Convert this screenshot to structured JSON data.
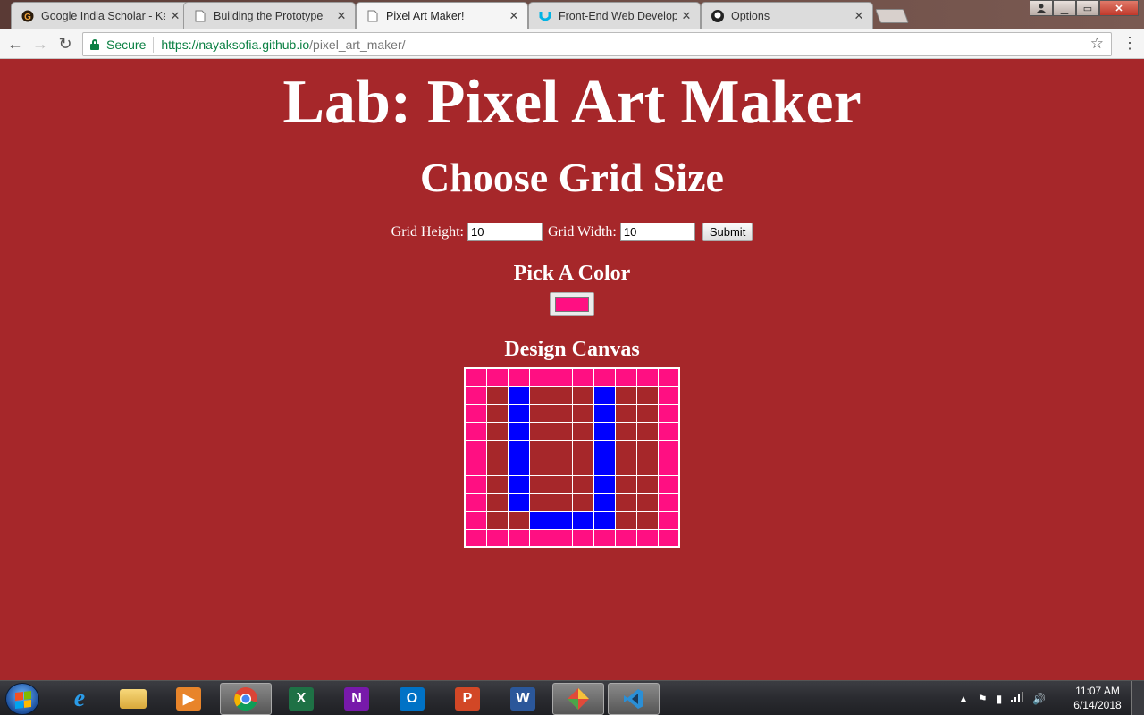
{
  "browser": {
    "tabs": [
      {
        "title": "Google India Scholar - Ka",
        "icon": "kaggle-like-icon"
      },
      {
        "title": "Building the Prototype",
        "icon": "page-icon"
      },
      {
        "title": "Pixel Art Maker!",
        "icon": "page-icon",
        "active": true
      },
      {
        "title": "Front-End Web Develope",
        "icon": "udacity-icon"
      },
      {
        "title": "Options",
        "icon": "github-icon"
      }
    ],
    "secure_label": "Secure",
    "url_host": "https://nayaksofia.github.io",
    "url_path": "/pixel_art_maker/"
  },
  "page": {
    "title": "Lab: Pixel Art Maker",
    "grid_heading": "Choose Grid Size",
    "height_label": "Grid Height:",
    "height_value": "10",
    "width_label": "Grid Width:",
    "width_value": "10",
    "submit_label": "Submit",
    "color_heading": "Pick A Color",
    "color_value": "#ff0f82",
    "canvas_heading": "Design Canvas"
  },
  "canvas": {
    "rows": 10,
    "cols": 10,
    "colors": {
      "0": "#a6272a",
      "1": "#ff0f82",
      "2": "#0000ff"
    },
    "cells": [
      "1111111111",
      "1020002001",
      "1020002001",
      "1020002001",
      "1020002001",
      "1020002001",
      "1020002001",
      "1020002001",
      "1002222001",
      "1111111111"
    ]
  },
  "taskbar": {
    "apps": [
      "internet-explorer",
      "file-explorer",
      "media-player",
      "chrome",
      "excel",
      "onenote",
      "outlook",
      "powerpoint",
      "word",
      "snipping-tool",
      "visual-studio-code"
    ],
    "time": "11:07 AM",
    "date": "6/14/2018"
  },
  "theme": {
    "page_bg": "#a6272a",
    "pink": "#ff0f82",
    "blue": "#0000ff"
  }
}
